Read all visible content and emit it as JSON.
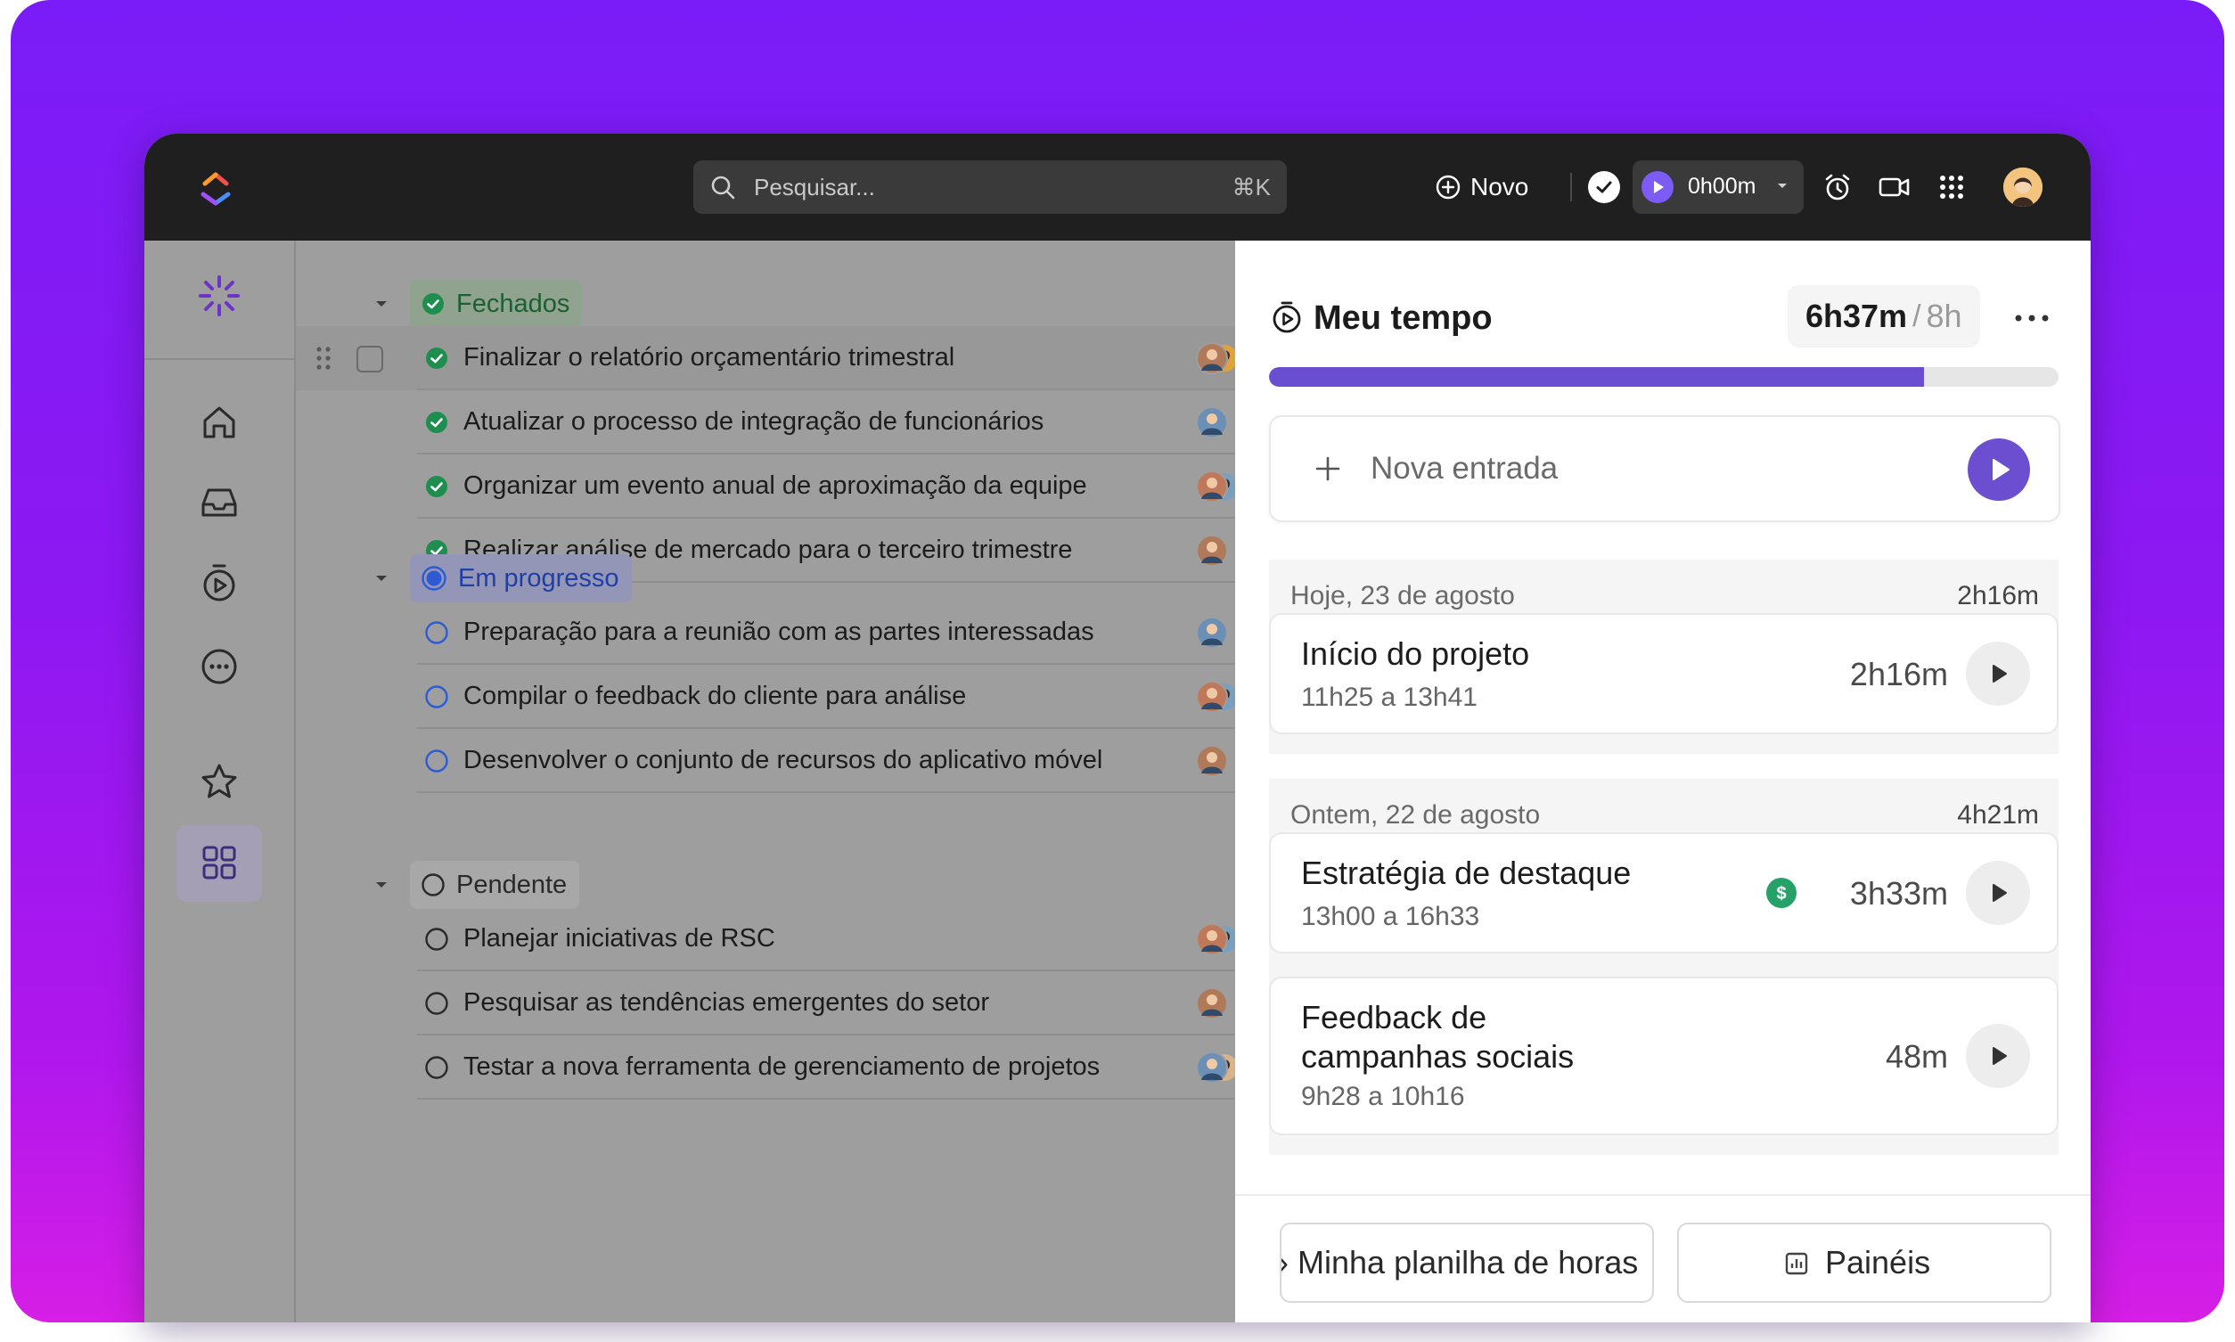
{
  "topbar": {
    "search_placeholder": "Pesquisar...",
    "search_shortcut": "⌘K",
    "new_label": "Novo",
    "timer_value": "0h00m"
  },
  "groups": [
    {
      "label": "Fechados",
      "status": "closed",
      "tasks": [
        "Finalizar o relatório orçamentário trimestral",
        "Atualizar o processo de integração de funcionários",
        "Organizar um evento anual de aproximação da equipe",
        "Realizar análise de mercado para o terceiro trimestre"
      ]
    },
    {
      "label": "Em progresso",
      "status": "in-progress",
      "tasks": [
        "Preparação para a reunião com as partes interessadas",
        "Compilar o feedback do cliente para análise",
        "Desenvolver o conjunto de recursos do aplicativo móvel"
      ]
    },
    {
      "label": "Pendente",
      "status": "pending",
      "tasks": [
        "Planejar iniciativas de RSC",
        "Pesquisar as tendências emergentes do setor",
        "Testar a nova ferramenta de gerenciamento de projetos"
      ]
    }
  ],
  "panel": {
    "title": "Meu tempo",
    "total_tracked": "6h37m",
    "separator": "/",
    "goal": "8h",
    "progress_fraction": 0.83,
    "new_entry_label": "Nova entrada",
    "days": [
      {
        "label": "Hoje, 23 de agosto",
        "total": "2h16m",
        "entries": [
          {
            "title": "Início do projeto",
            "range": "11h25 a 13h41",
            "duration": "2h16m",
            "billable": false
          }
        ]
      },
      {
        "label": "Ontem, 22 de agosto",
        "total": "4h21m",
        "entries": [
          {
            "title": "Estratégia de destaque",
            "range": "13h00 a 16h33",
            "duration": "3h33m",
            "billable": true
          },
          {
            "title": "Feedback de campanhas sociais",
            "range": "9h28 a 10h16",
            "duration": "48m",
            "billable": false
          }
        ]
      }
    ],
    "billable_symbol": "$",
    "footer": {
      "timesheet_label": "Minha planilha de horas",
      "dashboards_label": "Painéis"
    }
  },
  "colors": {
    "accent": "#6b4fd0",
    "closed": "#1e8e4e",
    "in_progress": "#2d5bd4",
    "billable": "#26a269"
  }
}
